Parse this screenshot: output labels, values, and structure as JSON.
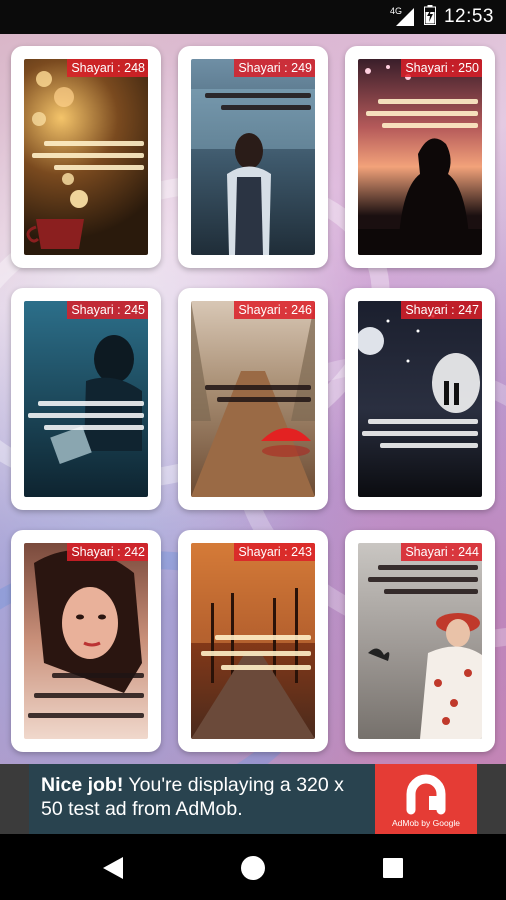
{
  "status_bar": {
    "time": "12:53",
    "network_label": "4G"
  },
  "cards": [
    {
      "badge": "Shayari : 248",
      "scene": "candles-cup"
    },
    {
      "badge": "Shayari : 249",
      "scene": "girl-in-rain"
    },
    {
      "badge": "Shayari : 250",
      "scene": "silhouette-sunset"
    },
    {
      "badge": "Shayari : 245",
      "scene": "sad-girl-blue"
    },
    {
      "badge": "Shayari : 246",
      "scene": "bridge-red-umbrella"
    },
    {
      "badge": "Shayari : 247",
      "scene": "couple-moon-night"
    },
    {
      "badge": "Shayari : 242",
      "scene": "woman-portrait"
    },
    {
      "badge": "Shayari : 243",
      "scene": "autumn-road"
    },
    {
      "badge": "Shayari : 244",
      "scene": "girl-hat-beach"
    }
  ],
  "ad": {
    "headline": "Nice job!",
    "message": " You're displaying a 320 x 50 test ad from AdMob.",
    "brand": "AdMob by Google"
  },
  "colors": {
    "badge": "#dc1e28",
    "ad_background": "#29434f",
    "ad_logo": "#e53c35"
  }
}
